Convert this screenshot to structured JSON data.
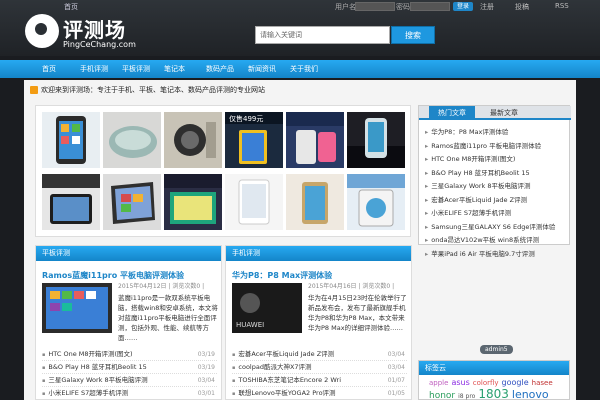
{
  "topbar": {
    "home": "首页",
    "login_label": "用户名",
    "password_label": "密码",
    "login_button": "登录",
    "items": [
      "注册",
      "投稿",
      "RSS"
    ]
  },
  "logo": {
    "cn": "评测场",
    "en": "PingCeChang.com"
  },
  "search": {
    "placeholder": "请输入关键词",
    "button": "搜索"
  },
  "nav": [
    "首页",
    "手机评测",
    "平板评测",
    "笔记本",
    "数码产品",
    "新闻资讯",
    "关于我们"
  ],
  "notice": "欢迎来到评测场：专注于手机、平板、笔记本、数码产品评测的专业网站",
  "gallery_captions": [
    [
      "",
      "",
      "",
      "仅售499元",
      "",
      "",
      ""
    ],
    [
      "",
      "",
      "",
      "",
      "",
      "",
      ""
    ]
  ],
  "side_tabs": {
    "tab1": "热门文章",
    "tab2": "最新文章"
  },
  "side_list": [
    "华为P8：P8 Max评测体验",
    "Ramos蓝魔i11pro 平板电脑评测体验",
    "HTC One M8开箱评测(图文)",
    "B&O Play H8 蓝牙耳机Beolit 15",
    "三星Galaxy Work 8平板电脑评测",
    "宏碁Acer平板Liquid Jade Z评测",
    "小米ELIFE S7超薄手机评测",
    "Samsung三星GALAXY S6 Edge评测体验",
    "onda昂达V102w平板 win8系统评测",
    "苹果iPad i6 Air 平板电脑9.7寸评测"
  ],
  "panel_left": {
    "head": "平板评测",
    "title": "Ramos蓝魔i11pro 平板电脑评测体验",
    "meta": "2015年04月12日 | 浏览次数0 |",
    "desc": "蓝魔i11pro是一款双系统平板电脑，搭载win8和安卓系统，本文将对蓝魔i11pro平板电脑进行全面评测，包括外观、性能、续航等方面……",
    "list": [
      {
        "t": "HTC One M8开箱评测(图文)",
        "d": "03/19"
      },
      {
        "t": "B&O Play H8 蓝牙耳机Beolit 15",
        "d": "03/19"
      },
      {
        "t": "三星Galaxy Work 8平板电脑评测",
        "d": "03/04"
      },
      {
        "t": "小米ELIFE S7超薄手机评测",
        "d": "03/01"
      }
    ]
  },
  "panel_right": {
    "head": "手机评测",
    "title": "华为P8：P8 Max评测体验",
    "meta": "2015年04月16日 | 浏览次数0 |",
    "desc": "华为在4月15日23时在伦敦举行了新品发布会，发布了最新旗舰手机华为P8和华为P8 Max，本文带来华为P8 Max的详细评测体验……",
    "list": [
      {
        "t": "宏碁Acer平板Liquid Jade Z评测",
        "d": "03/04"
      },
      {
        "t": "coolpad酷派大神X7评测",
        "d": "03/04"
      },
      {
        "t": "TOSHIBA东芝笔记本Encore 2 Wri",
        "d": "01/07"
      },
      {
        "t": "联想Lenovo平板YOGA2 Pro评测",
        "d": "01/05"
      }
    ]
  },
  "admin_pill": "admin5",
  "tag_head": "标签云",
  "tags": [
    {
      "t": "apple",
      "c": "#c060c0",
      "s": 7
    },
    {
      "t": "asus",
      "c": "#8a2be2",
      "s": 8
    },
    {
      "t": "colorfly",
      "c": "#e05050",
      "s": 7
    },
    {
      "t": "google",
      "c": "#3050c0",
      "s": 8
    },
    {
      "t": "hasee",
      "c": "#c03030",
      "s": 7
    },
    {
      "t": "honor",
      "c": "#2a9d5c",
      "s": 9
    },
    {
      "t": "i8 pro",
      "c": "#555",
      "s": 6
    },
    {
      "t": "1803",
      "c": "#2aa070",
      "s": 12
    },
    {
      "t": "lenovo",
      "c": "#2070c0",
      "s": 11
    }
  ]
}
